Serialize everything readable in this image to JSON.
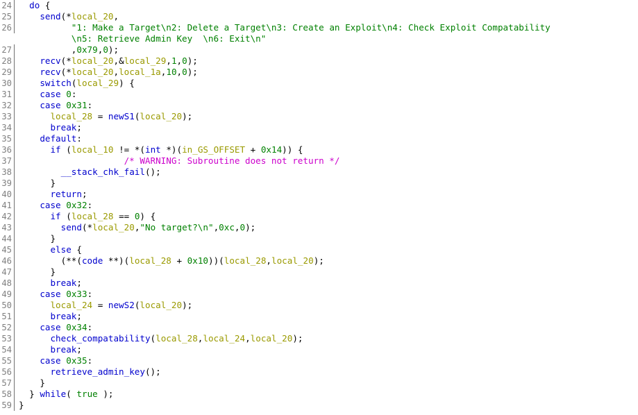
{
  "view": {
    "name": "ghidra-decompiler",
    "title": "Decompiler Code Listing",
    "background": "#ffffff",
    "gutter_rule_color": "#707070",
    "line_number_color": "#808080"
  },
  "palette": {
    "keyword": "#0000cd",
    "function": "#0000cd",
    "variable": "#9a9a00",
    "constant": "#008000",
    "string": "#008000",
    "comment_warning": "#cc00cc",
    "punctuation": "#000000"
  },
  "lines": [
    {
      "number": "24",
      "rule": true,
      "indent": 2,
      "tokens": [
        {
          "t": "do",
          "c": "kw"
        },
        {
          "t": " {",
          "c": "punct"
        }
      ]
    },
    {
      "number": "25",
      "rule": true,
      "indent": 4,
      "tokens": [
        {
          "t": "send",
          "c": "fn"
        },
        {
          "t": "(*",
          "c": "punct"
        },
        {
          "t": "local_20",
          "c": "var"
        },
        {
          "t": ",",
          "c": "punct"
        }
      ]
    },
    {
      "number": "26",
      "rule": true,
      "indent": 10,
      "tokens": [
        {
          "t": "\"1: Make a Target\\n2: Delete a Target\\n3: Create an Exploit\\n4: Check Exploit Compatability",
          "c": "str"
        }
      ]
    },
    {
      "number": "",
      "rule": false,
      "indent": 10,
      "tokens": [
        {
          "t": "\\n5: Retrieve Admin Key  \\n6: Exit\\n\"",
          "c": "str"
        }
      ]
    },
    {
      "number": "27",
      "rule": true,
      "indent": 10,
      "tokens": [
        {
          "t": ",",
          "c": "punct"
        },
        {
          "t": "0x79",
          "c": "const"
        },
        {
          "t": ",",
          "c": "punct"
        },
        {
          "t": "0",
          "c": "const"
        },
        {
          "t": ");",
          "c": "punct"
        }
      ]
    },
    {
      "number": "28",
      "rule": true,
      "indent": 4,
      "tokens": [
        {
          "t": "recv",
          "c": "fn"
        },
        {
          "t": "(*",
          "c": "punct"
        },
        {
          "t": "local_20",
          "c": "var"
        },
        {
          "t": ",&",
          "c": "punct"
        },
        {
          "t": "local_29",
          "c": "var"
        },
        {
          "t": ",",
          "c": "punct"
        },
        {
          "t": "1",
          "c": "const"
        },
        {
          "t": ",",
          "c": "punct"
        },
        {
          "t": "0",
          "c": "const"
        },
        {
          "t": ");",
          "c": "punct"
        }
      ]
    },
    {
      "number": "29",
      "rule": true,
      "indent": 4,
      "tokens": [
        {
          "t": "recv",
          "c": "fn"
        },
        {
          "t": "(*",
          "c": "punct"
        },
        {
          "t": "local_20",
          "c": "var"
        },
        {
          "t": ",",
          "c": "punct"
        },
        {
          "t": "local_1a",
          "c": "var"
        },
        {
          "t": ",",
          "c": "punct"
        },
        {
          "t": "10",
          "c": "const"
        },
        {
          "t": ",",
          "c": "punct"
        },
        {
          "t": "0",
          "c": "const"
        },
        {
          "t": ");",
          "c": "punct"
        }
      ]
    },
    {
      "number": "30",
      "rule": true,
      "indent": 4,
      "tokens": [
        {
          "t": "switch",
          "c": "kw"
        },
        {
          "t": "(",
          "c": "punct"
        },
        {
          "t": "local_29",
          "c": "var"
        },
        {
          "t": ") {",
          "c": "punct"
        }
      ]
    },
    {
      "number": "31",
      "rule": true,
      "indent": 4,
      "tokens": [
        {
          "t": "case",
          "c": "kw"
        },
        {
          "t": " ",
          "c": "punct"
        },
        {
          "t": "0",
          "c": "const"
        },
        {
          "t": ":",
          "c": "punct"
        }
      ]
    },
    {
      "number": "32",
      "rule": true,
      "indent": 4,
      "tokens": [
        {
          "t": "case",
          "c": "kw"
        },
        {
          "t": " ",
          "c": "punct"
        },
        {
          "t": "0x31",
          "c": "const"
        },
        {
          "t": ":",
          "c": "punct"
        }
      ]
    },
    {
      "number": "33",
      "rule": true,
      "indent": 6,
      "tokens": [
        {
          "t": "local_28",
          "c": "var"
        },
        {
          "t": " = ",
          "c": "punct"
        },
        {
          "t": "newS1",
          "c": "fn"
        },
        {
          "t": "(",
          "c": "punct"
        },
        {
          "t": "local_20",
          "c": "var"
        },
        {
          "t": ");",
          "c": "punct"
        }
      ]
    },
    {
      "number": "34",
      "rule": true,
      "indent": 6,
      "tokens": [
        {
          "t": "break",
          "c": "kw"
        },
        {
          "t": ";",
          "c": "punct"
        }
      ]
    },
    {
      "number": "35",
      "rule": true,
      "indent": 4,
      "tokens": [
        {
          "t": "default",
          "c": "kw"
        },
        {
          "t": ":",
          "c": "punct"
        }
      ]
    },
    {
      "number": "36",
      "rule": true,
      "indent": 6,
      "tokens": [
        {
          "t": "if",
          "c": "kw"
        },
        {
          "t": " (",
          "c": "punct"
        },
        {
          "t": "local_10",
          "c": "var"
        },
        {
          "t": " != *(",
          "c": "punct"
        },
        {
          "t": "int",
          "c": "kw"
        },
        {
          "t": " *)(",
          "c": "punct"
        },
        {
          "t": "in_GS_OFFSET",
          "c": "var"
        },
        {
          "t": " + ",
          "c": "punct"
        },
        {
          "t": "0x14",
          "c": "const"
        },
        {
          "t": ")) {",
          "c": "punct"
        }
      ]
    },
    {
      "number": "37",
      "rule": true,
      "indent": 20,
      "tokens": [
        {
          "t": "/* WARNING: Subroutine does not return */",
          "c": "warn"
        }
      ]
    },
    {
      "number": "38",
      "rule": true,
      "indent": 8,
      "tokens": [
        {
          "t": "__stack_chk_fail",
          "c": "fn"
        },
        {
          "t": "();",
          "c": "punct"
        }
      ]
    },
    {
      "number": "39",
      "rule": true,
      "indent": 6,
      "tokens": [
        {
          "t": "}",
          "c": "punct"
        }
      ]
    },
    {
      "number": "40",
      "rule": true,
      "indent": 6,
      "tokens": [
        {
          "t": "return",
          "c": "kw"
        },
        {
          "t": ";",
          "c": "punct"
        }
      ]
    },
    {
      "number": "41",
      "rule": true,
      "indent": 4,
      "tokens": [
        {
          "t": "case",
          "c": "kw"
        },
        {
          "t": " ",
          "c": "punct"
        },
        {
          "t": "0x32",
          "c": "const"
        },
        {
          "t": ":",
          "c": "punct"
        }
      ]
    },
    {
      "number": "42",
      "rule": true,
      "indent": 6,
      "tokens": [
        {
          "t": "if",
          "c": "kw"
        },
        {
          "t": " (",
          "c": "punct"
        },
        {
          "t": "local_28",
          "c": "var"
        },
        {
          "t": " == ",
          "c": "punct"
        },
        {
          "t": "0",
          "c": "const"
        },
        {
          "t": ") {",
          "c": "punct"
        }
      ]
    },
    {
      "number": "43",
      "rule": true,
      "indent": 8,
      "tokens": [
        {
          "t": "send",
          "c": "fn"
        },
        {
          "t": "(*",
          "c": "punct"
        },
        {
          "t": "local_20",
          "c": "var"
        },
        {
          "t": ",",
          "c": "punct"
        },
        {
          "t": "\"No target?\\n\"",
          "c": "str"
        },
        {
          "t": ",",
          "c": "punct"
        },
        {
          "t": "0xc",
          "c": "const"
        },
        {
          "t": ",",
          "c": "punct"
        },
        {
          "t": "0",
          "c": "const"
        },
        {
          "t": ");",
          "c": "punct"
        }
      ]
    },
    {
      "number": "44",
      "rule": true,
      "indent": 6,
      "tokens": [
        {
          "t": "}",
          "c": "punct"
        }
      ]
    },
    {
      "number": "45",
      "rule": true,
      "indent": 6,
      "tokens": [
        {
          "t": "else",
          "c": "kw"
        },
        {
          "t": " {",
          "c": "punct"
        }
      ]
    },
    {
      "number": "46",
      "rule": true,
      "indent": 8,
      "tokens": [
        {
          "t": "(**(",
          "c": "punct"
        },
        {
          "t": "code",
          "c": "kw"
        },
        {
          "t": " **)(",
          "c": "punct"
        },
        {
          "t": "local_28",
          "c": "var"
        },
        {
          "t": " + ",
          "c": "punct"
        },
        {
          "t": "0x10",
          "c": "const"
        },
        {
          "t": "))(",
          "c": "punct"
        },
        {
          "t": "local_28",
          "c": "var"
        },
        {
          "t": ",",
          "c": "punct"
        },
        {
          "t": "local_20",
          "c": "var"
        },
        {
          "t": ");",
          "c": "punct"
        }
      ]
    },
    {
      "number": "47",
      "rule": true,
      "indent": 6,
      "tokens": [
        {
          "t": "}",
          "c": "punct"
        }
      ]
    },
    {
      "number": "48",
      "rule": true,
      "indent": 6,
      "tokens": [
        {
          "t": "break",
          "c": "kw"
        },
        {
          "t": ";",
          "c": "punct"
        }
      ]
    },
    {
      "number": "49",
      "rule": true,
      "indent": 4,
      "tokens": [
        {
          "t": "case",
          "c": "kw"
        },
        {
          "t": " ",
          "c": "punct"
        },
        {
          "t": "0x33",
          "c": "const"
        },
        {
          "t": ":",
          "c": "punct"
        }
      ]
    },
    {
      "number": "50",
      "rule": true,
      "indent": 6,
      "tokens": [
        {
          "t": "local_24",
          "c": "var"
        },
        {
          "t": " = ",
          "c": "punct"
        },
        {
          "t": "newS2",
          "c": "fn"
        },
        {
          "t": "(",
          "c": "punct"
        },
        {
          "t": "local_20",
          "c": "var"
        },
        {
          "t": ");",
          "c": "punct"
        }
      ]
    },
    {
      "number": "51",
      "rule": true,
      "indent": 6,
      "tokens": [
        {
          "t": "break",
          "c": "kw"
        },
        {
          "t": ";",
          "c": "punct"
        }
      ]
    },
    {
      "number": "52",
      "rule": true,
      "indent": 4,
      "tokens": [
        {
          "t": "case",
          "c": "kw"
        },
        {
          "t": " ",
          "c": "punct"
        },
        {
          "t": "0x34",
          "c": "const"
        },
        {
          "t": ":",
          "c": "punct"
        }
      ]
    },
    {
      "number": "53",
      "rule": true,
      "indent": 6,
      "tokens": [
        {
          "t": "check_compatability",
          "c": "fn"
        },
        {
          "t": "(",
          "c": "punct"
        },
        {
          "t": "local_28",
          "c": "var"
        },
        {
          "t": ",",
          "c": "punct"
        },
        {
          "t": "local_24",
          "c": "var"
        },
        {
          "t": ",",
          "c": "punct"
        },
        {
          "t": "local_20",
          "c": "var"
        },
        {
          "t": ");",
          "c": "punct"
        }
      ]
    },
    {
      "number": "54",
      "rule": true,
      "indent": 6,
      "tokens": [
        {
          "t": "break",
          "c": "kw"
        },
        {
          "t": ";",
          "c": "punct"
        }
      ]
    },
    {
      "number": "55",
      "rule": true,
      "indent": 4,
      "tokens": [
        {
          "t": "case",
          "c": "kw"
        },
        {
          "t": " ",
          "c": "punct"
        },
        {
          "t": "0x35",
          "c": "const"
        },
        {
          "t": ":",
          "c": "punct"
        }
      ]
    },
    {
      "number": "56",
      "rule": true,
      "indent": 6,
      "tokens": [
        {
          "t": "retrieve_admin_key",
          "c": "fn"
        },
        {
          "t": "();",
          "c": "punct"
        }
      ]
    },
    {
      "number": "57",
      "rule": true,
      "indent": 4,
      "tokens": [
        {
          "t": "}",
          "c": "punct"
        }
      ]
    },
    {
      "number": "58",
      "rule": true,
      "indent": 2,
      "tokens": [
        {
          "t": "} ",
          "c": "punct"
        },
        {
          "t": "while",
          "c": "kw"
        },
        {
          "t": "( ",
          "c": "punct"
        },
        {
          "t": "true",
          "c": "const"
        },
        {
          "t": " );",
          "c": "punct"
        }
      ]
    },
    {
      "number": "59",
      "rule": true,
      "indent": 0,
      "tokens": [
        {
          "t": "}",
          "c": "punct"
        }
      ]
    }
  ]
}
